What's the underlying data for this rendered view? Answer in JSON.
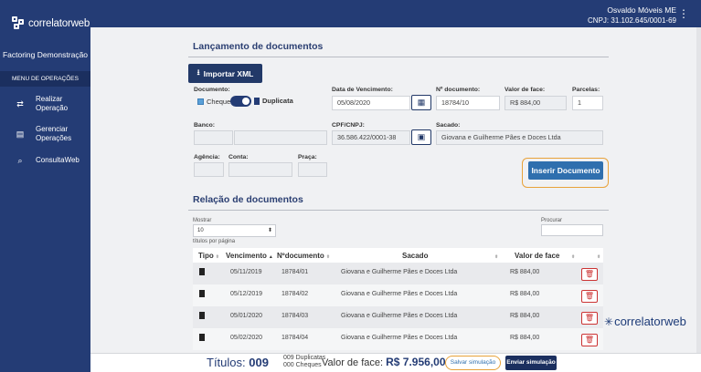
{
  "app": {
    "logo_text": "correlatorweb",
    "company": "Factoring Demonstração",
    "menu_header": "MENU DE OPERAÇÕES"
  },
  "sidebar": {
    "items": [
      {
        "label": "Realizar Operação",
        "icon": "exchange-icon"
      },
      {
        "label": "Gerenciar Operações",
        "icon": "clipboard-icon"
      },
      {
        "label": "ConsultaWeb",
        "icon": "search-icon"
      }
    ]
  },
  "topbar": {
    "user": "Osvaldo Móveis ME",
    "cnpj": "CNPJ: 31.102.645/0001-69"
  },
  "launch": {
    "title": "Lançamento de documentos",
    "import_button": "Importar XML",
    "document_label": "Documento:",
    "cheque_label": "Cheque",
    "duplicata_label": "Duplicata",
    "due_label": "Data de Vencimento:",
    "due_value": "05/08/2020",
    "docnum_label": "Nº documento:",
    "docnum_value": "18784/10",
    "face_label": "Valor de face:",
    "face_value": "R$ 884,00",
    "installments_label": "Parcelas:",
    "installments_value": "1",
    "bank_label": "Banco:",
    "cpf_label": "CPF/CNPJ:",
    "cpf_value": "36.586.422/0001-38",
    "drawee_label": "Sacado:",
    "drawee_value": "Giovana e Guilherme Pães e Doces Ltda",
    "agency_label": "Agência:",
    "account_label": "Conta:",
    "square_label": "Praça:",
    "insert_button": "Inserir Documento"
  },
  "relation": {
    "title": "Relação de documentos",
    "show_label": "Mostrar",
    "page_size": "10",
    "per_page": "títulos por página",
    "search_label": "Procurar",
    "columns": [
      "Tipo",
      "Vencimento",
      "Nºdocumento",
      "Sacado",
      "Valor de face"
    ],
    "rows": [
      {
        "due": "05/11/2019",
        "num": "18784/01",
        "drawee": "Giovana e Guilherme Pães e Doces Ltda",
        "value": "R$ 884,00"
      },
      {
        "due": "05/12/2019",
        "num": "18784/02",
        "drawee": "Giovana e Guilherme Pães e Doces Ltda",
        "value": "R$ 884,00"
      },
      {
        "due": "05/01/2020",
        "num": "18784/03",
        "drawee": "Giovana e Guilherme Pães e Doces Ltda",
        "value": "R$ 884,00"
      },
      {
        "due": "05/02/2020",
        "num": "18784/04",
        "drawee": "Giovana e Guilherme Pães e Doces Ltda",
        "value": "R$ 884,00"
      }
    ]
  },
  "watermark": "correlatorweb",
  "footer": {
    "titles_label": "Títulos:",
    "titles_count": "009",
    "duplicatas": "009 Duplicatas",
    "cheques": "000 Cheques",
    "value_label": "Valor de face:",
    "value": "R$ 7.956,00",
    "save_button": "Salvar simulação",
    "send_button": "Enviar simulação"
  },
  "colors": {
    "primary": "#243c75",
    "accent": "#e8a23a",
    "insert": "#2f6fae",
    "danger": "#cc3333"
  }
}
